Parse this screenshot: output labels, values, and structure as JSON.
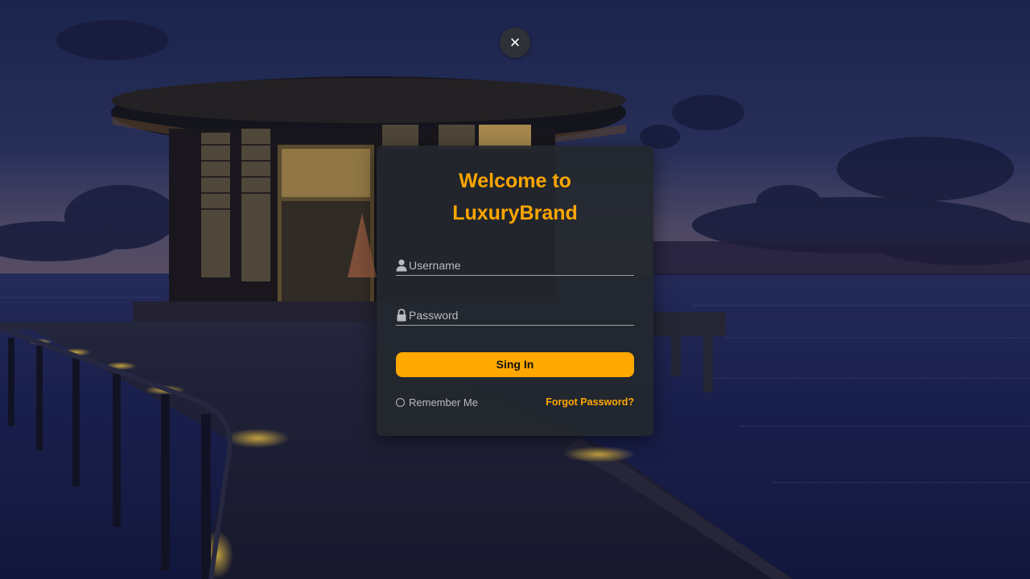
{
  "modal": {
    "close_label": "×",
    "title_line1": "Welcome to",
    "title_line2": "LuxuryBrand",
    "username_placeholder": "Username",
    "username_value": "",
    "password_placeholder": "Password",
    "password_value": "",
    "signin_label": "Sing In",
    "remember_label": "Remember Me",
    "remember_checked": false,
    "forgot_label": "Forgot Password?"
  },
  "icons": {
    "close": "close-icon",
    "username": "user-icon",
    "password": "lock-icon"
  },
  "colors": {
    "accent": "#ffa800",
    "card_bg": "#24282d",
    "field_line": "#9ea2a8",
    "muted_text": "#b9bdc3"
  }
}
